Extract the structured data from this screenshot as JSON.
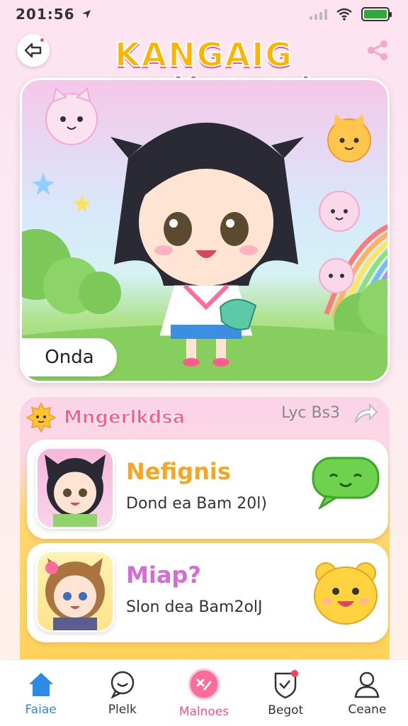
{
  "status": {
    "time": "201:56"
  },
  "header": {
    "title_line1": "KANGAIG",
    "title_line2": "mop Veeesm!"
  },
  "hero": {
    "badge": "Onda"
  },
  "section": {
    "title": "Mngerlkdsa",
    "link": "Lyc Bs3"
  },
  "cards": [
    {
      "name": "Nefignis",
      "subtitle": "Dond ea Bam 20l)",
      "name_color": "#f5a623"
    },
    {
      "name": "Miap?",
      "subtitle": "Slon dea Bam2olJ",
      "name_color": "#d86ad8"
    }
  ],
  "tabs": [
    {
      "label": "Faiae",
      "icon": "home-icon"
    },
    {
      "label": "Plelk",
      "icon": "chat-icon"
    },
    {
      "label": "Malnoes",
      "icon": "tags-icon"
    },
    {
      "label": "Begot",
      "icon": "shield-icon"
    },
    {
      "label": "Ceane",
      "icon": "user-icon"
    }
  ],
  "colors": {
    "accent_pink": "#ff4f8a",
    "accent_blue": "#2d8be6",
    "accent_yellow": "#ffd35a"
  }
}
